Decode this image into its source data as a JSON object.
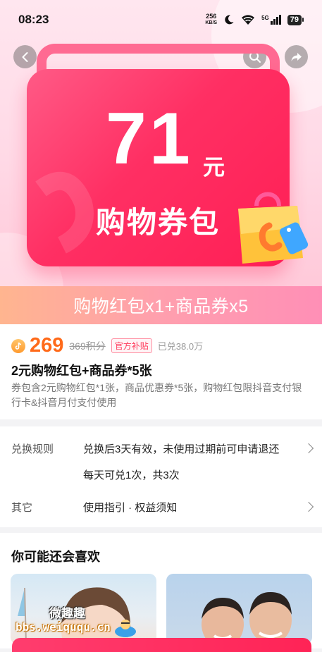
{
  "status_bar": {
    "time": "08:23",
    "net_speed_value": "256",
    "net_speed_unit": "KB/S",
    "network": "5G",
    "battery": "79"
  },
  "icons": {
    "back": "back-arrow-icon",
    "search": "search-icon",
    "share": "share-icon",
    "coin": "douyin-coin-icon",
    "chevron": "chevron-right-icon"
  },
  "hero": {
    "amount": "71",
    "unit": "元",
    "name": "购物券包",
    "banner": "购物红包x1+商品券x5"
  },
  "product": {
    "price": "269",
    "original_price": "369积分",
    "subsidy_tag": "官方补贴",
    "sold": "已兑38.0万",
    "title": "2元购物红包+商品券*5张",
    "description": "券包含2元购物红包*1张，商品优惠券*5张，购物红包限抖音支付银行卡&抖音月付支付使用"
  },
  "rules": {
    "exchange_label": "兑换规则",
    "exchange_line1": "兑换后3天有效，未使用过期前可申请退还",
    "exchange_line2": "每天可兑1次，共3次",
    "other_label": "其它",
    "other_text": "使用指引 · 权益须知"
  },
  "recommend": {
    "title": "你可能还会喜欢"
  },
  "watermark": {
    "title": "微趣趣",
    "url": "bbs.weiququ.cn"
  },
  "colors": {
    "accent": "#ff2f63",
    "price": "#ff6a1a",
    "banner_start": "#ffb58f",
    "banner_end": "#ff8fb6"
  }
}
